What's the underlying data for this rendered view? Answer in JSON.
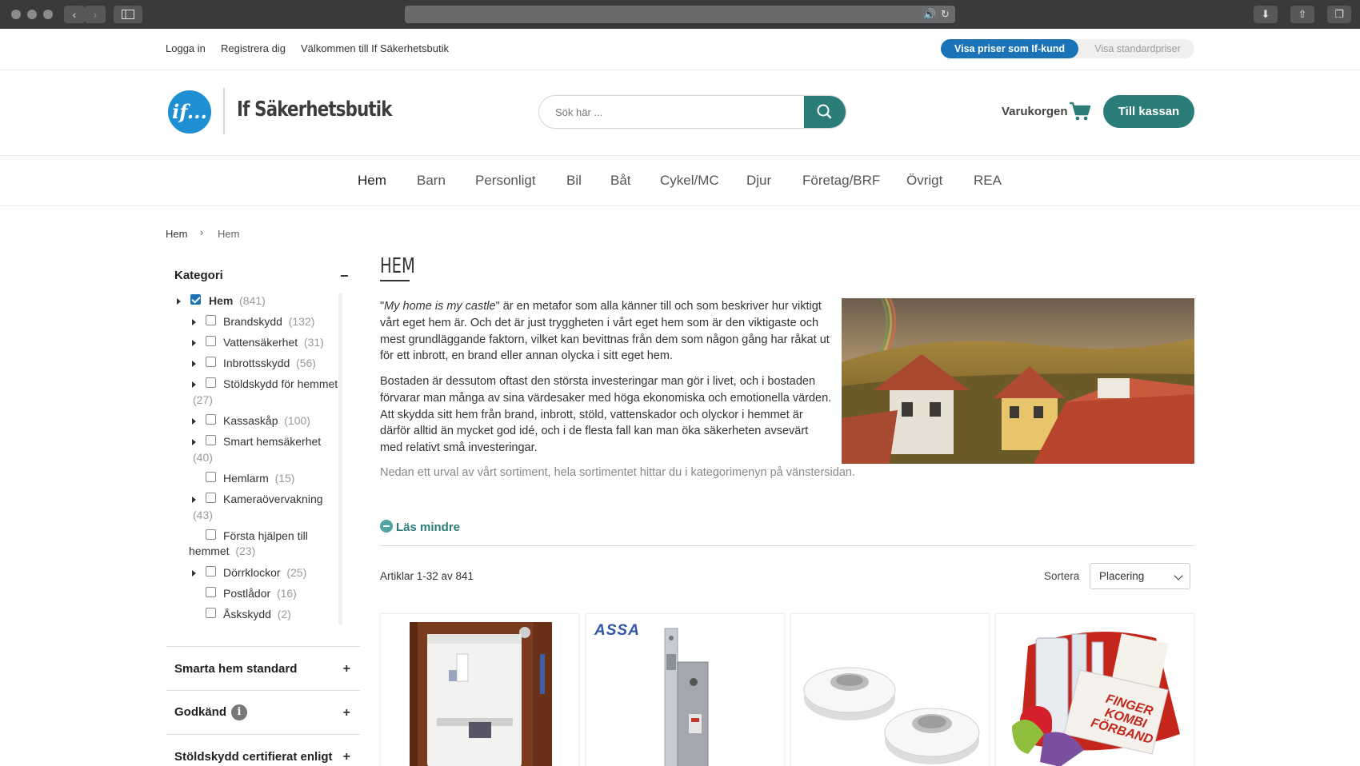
{
  "topbar": {
    "login": "Logga in",
    "register": "Registrera dig",
    "welcome": "Välkommen till If Säkerhetsbutik",
    "price_if": "Visa priser som If-kund",
    "price_standard": "Visa standardpriser"
  },
  "header": {
    "logo_mark": "if...",
    "logo_text": "If Säkerhetsbutik",
    "search_placeholder": "Sök här ...",
    "cart_label": "Varukorgen",
    "checkout_label": "Till kassan"
  },
  "nav": [
    "Hem",
    "Barn",
    "Personligt",
    "Bil",
    "Båt",
    "Cykel/MC",
    "Djur",
    "Företag/BRF",
    "Övrigt",
    "REA"
  ],
  "breadcrumb": [
    "Hem",
    "Hem"
  ],
  "sidebar": {
    "title": "Kategori",
    "categories": [
      {
        "name": "Hem",
        "count": "(841)"
      },
      {
        "name": "Brandskydd",
        "count": "(132)"
      },
      {
        "name": "Vattensäkerhet",
        "count": "(31)"
      },
      {
        "name": "Inbrottsskydd",
        "count": "(56)"
      },
      {
        "name": "Stöldskydd för hemmet",
        "count": "(27)"
      },
      {
        "name": "Kassaskåp",
        "count": "(100)"
      },
      {
        "name": "Smart hemsäkerhet",
        "count": "(40)"
      },
      {
        "name": "Hemlarm",
        "count": "(15)"
      },
      {
        "name": "Kameraövervakning",
        "count": "(43)"
      },
      {
        "name": "Första hjälpen till hemmet",
        "count": "(23)"
      },
      {
        "name": "Dörrklockor",
        "count": "(25)"
      },
      {
        "name": "Postlådor",
        "count": "(16)"
      },
      {
        "name": "Åskskydd",
        "count": "(2)"
      }
    ],
    "filters": [
      "Smarta hem standard",
      "Godkänd",
      "Stöldskydd certifierat enligt"
    ]
  },
  "content": {
    "title": "HEM",
    "p1_italic": "My home is my castle",
    "p1_rest": "\" är en metafor som alla känner till och som beskriver hur viktigt vårt eget hem är. Och det är just tryggheten i vårt eget hem som är den viktigaste och mest grundläggande faktorn, vilket kan bevittnas från dem som någon gång har råkat ut för ett inbrott, en brand eller annan olycka i sitt eget hem.",
    "p2": "Bostaden är dessutom oftast den största investeringar man gör i livet, och i bostaden förvarar man många av sina värdesaker med höga ekonomiska och emotionella värden. Att skydda sitt hem från brand, inbrott, stöld, vattenskador och olyckor i hemmet är därför alltid än mycket god idé, och i de flesta fall kan man öka säkerheten avsevärt med relativt små investeringar.",
    "p3": "Nedan ett urval av vårt sortiment, hela sortimentet hittar du i kategorimenyn på vänstersidan.",
    "less_link": "Läs mindre",
    "count_text": "Artiklar 1-32 av 841",
    "sort_label": "Sortera",
    "sort_value": "Placering",
    "assa_logo": "ASSA",
    "kit_text": "FINGER KOMBI FÖRBAND"
  },
  "colors": {
    "teal": "#2a7c79",
    "blue": "#1a73b6"
  }
}
